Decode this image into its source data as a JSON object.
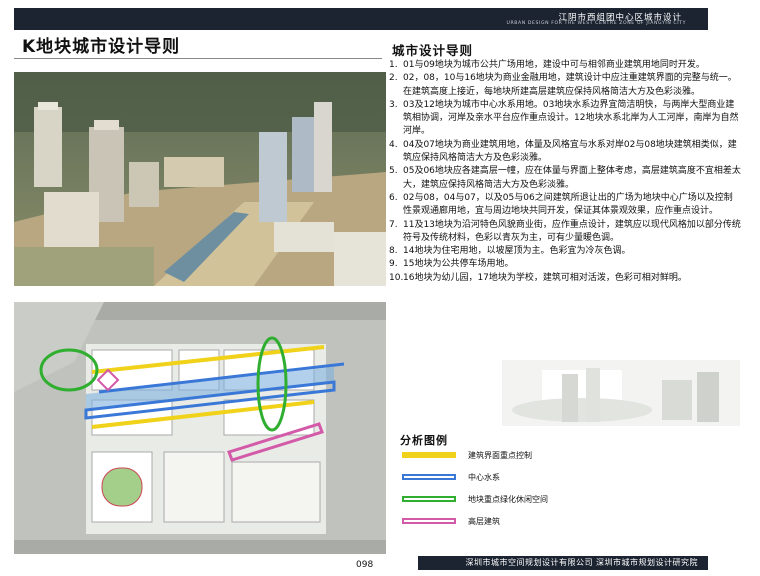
{
  "header": {
    "project_title": "江阴市西组团中心区城市设计",
    "project_subtitle": "URBAN DESIGN FOR THE WEST CENTRE ZONE OF JIANGYIN CITY"
  },
  "page_title": "K地块城市设计导则",
  "guidelines": {
    "heading": "城市设计导则",
    "items": [
      {
        "num": "1.",
        "text": "01与09地块为城市公共广场用地，建设中可与相邻商业建筑用地同时开发。"
      },
      {
        "num": "2.",
        "text": "02，08，10与16地块为商业金融用地，建筑设计中应注重建筑界面的完整与统一。在建筑高度上接近，每地块所建高层建筑应保持风格简洁大方及色彩淡雅。"
      },
      {
        "num": "3.",
        "text": "03及12地块为城市中心水系用地。03地块水系边界宜简洁明快，与两岸大型商业建筑相协调，河岸及亲水平台应作重点设计。12地块水系北岸为人工河岸，南岸为自然河岸。"
      },
      {
        "num": "4.",
        "text": "04及07地块为商业建筑用地，体量及风格宜与水系对岸02与08地块建筑相类似，建筑应保持风格简洁大方及色彩淡雅。"
      },
      {
        "num": "5.",
        "text": "05及06地块应各建高层一幢，应在体量与界面上整体考虑，高层建筑高度不宜相差太大，建筑应保持风格简洁大方及色彩淡雅。"
      },
      {
        "num": "6.",
        "text": "02与08，04与07，以及05与06之间建筑所退让出的广场为地块中心广场以及控制性景观通廊用地，宜与周边地块共同开发，保证其体景观效果，应作重点设计。"
      },
      {
        "num": "7.",
        "text": "11及13地块为沿河特色风貌商业街，应作重点设计，建筑应以现代风格加以部分传统符号及传统材料，色彩以青灰为主，可有少量暖色调。"
      },
      {
        "num": "8.",
        "text": "14地块为住宅用地，以坡屋顶为主。色彩宜为冷灰色调。"
      },
      {
        "num": "9.",
        "text": "15地块为公共停车场用地。"
      },
      {
        "num": "10.",
        "text": "16地块为幼儿园，17地块为学校，建筑可相对活泼，色彩可相对鲜明。"
      }
    ]
  },
  "legend": {
    "heading": "分析图例",
    "items": [
      {
        "label": "建筑界面重点控制",
        "color": "#f0d21a",
        "style": "fill"
      },
      {
        "label": "中心水系",
        "color": "#3a78d8",
        "style": "outline"
      },
      {
        "label": "地块重点绿化休闲空间",
        "color": "#2fae2f",
        "style": "outline"
      },
      {
        "label": "高层建筑",
        "color": "#d35aa8",
        "style": "outline"
      }
    ]
  },
  "footer": {
    "page_number": "098",
    "companies": "深圳市城市空间规划设计有限公司  深圳市城市规划设计研究院"
  }
}
